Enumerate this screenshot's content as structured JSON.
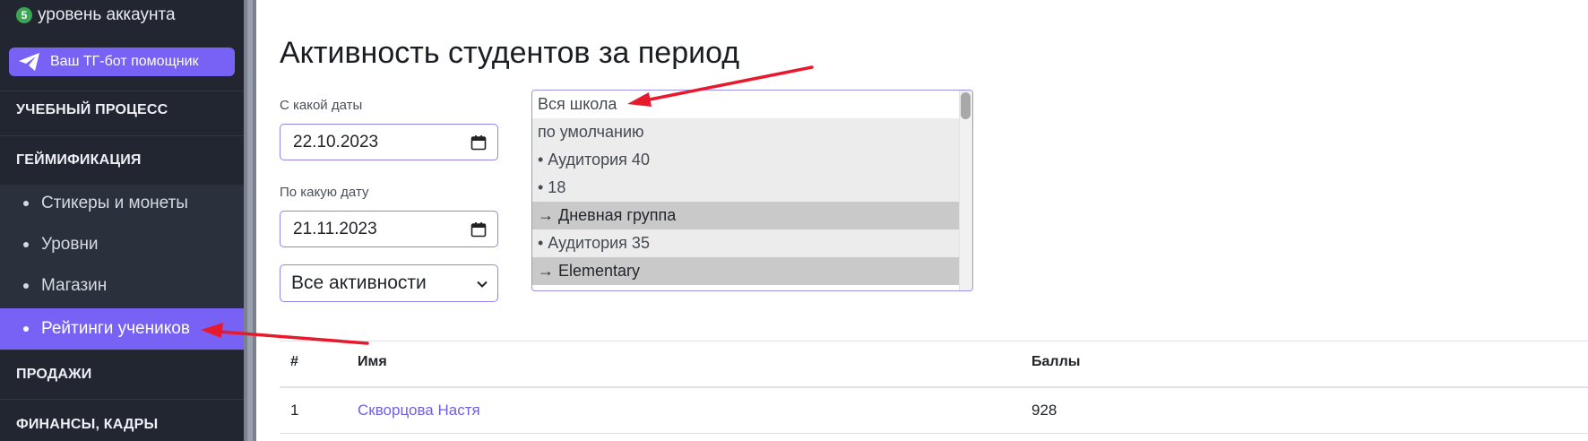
{
  "sidebar": {
    "level_badge": "5",
    "level_text": "уровень аккаунта",
    "tg_button_label": "Ваш ТГ-бот помощник",
    "tg_icon": "paper-plane-icon",
    "sections": {
      "learning": "УЧЕБНЫЙ ПРОЦЕСС",
      "gamification": "ГЕЙМИФИКАЦИЯ",
      "sales": "ПРОДАЖИ",
      "finance": "ФИНАНСЫ, КАДРЫ"
    },
    "gamification_items": [
      {
        "label": "Стикеры и монеты",
        "active": false
      },
      {
        "label": "Уровни",
        "active": false
      },
      {
        "label": "Магазин",
        "active": false
      },
      {
        "label": "Рейтинги учеников",
        "active": true
      }
    ]
  },
  "main": {
    "title": "Активность студентов за период",
    "from_label": "С какой даты",
    "from_value": "22.10.2023",
    "to_label": "По какую дату",
    "to_value": "21.11.2023",
    "activity_select": "Все активности",
    "group_list": [
      {
        "label": "Вся школа",
        "style": "white"
      },
      {
        "label": "по умолчанию",
        "style": "light"
      },
      {
        "label": "• Аудитория 40",
        "style": "light"
      },
      {
        "label": "• 18",
        "style": "light"
      },
      {
        "label": "→ Дневная группа",
        "style": "dark"
      },
      {
        "label": "• Аудитория 35",
        "style": "light"
      },
      {
        "label": "→ Elementary",
        "style": "dark"
      }
    ]
  },
  "table": {
    "headers": {
      "num": "#",
      "name": "Имя",
      "score": "Баллы"
    },
    "rows": [
      {
        "num": "1",
        "name": "Скворцова Настя",
        "score": "928"
      }
    ]
  },
  "colors": {
    "sidebar_bg": "#212631",
    "accent": "#7862f5",
    "link": "#6f5fe8",
    "annotation": "#e8192c"
  }
}
